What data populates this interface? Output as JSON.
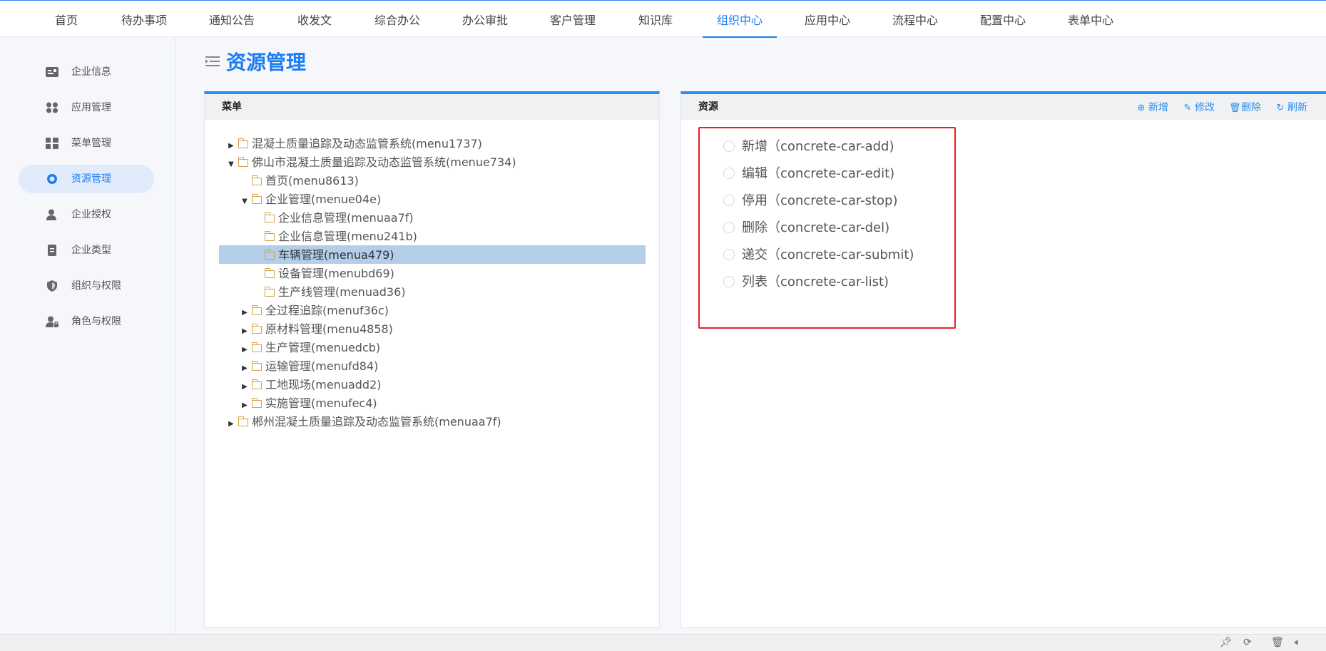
{
  "topnav": {
    "tabs": [
      {
        "label": "首页"
      },
      {
        "label": "待办事项"
      },
      {
        "label": "通知公告"
      },
      {
        "label": "收发文"
      },
      {
        "label": "综合办公"
      },
      {
        "label": "办公审批"
      },
      {
        "label": "客户管理"
      },
      {
        "label": "知识库"
      },
      {
        "label": "组织中心"
      },
      {
        "label": "应用中心"
      },
      {
        "label": "流程中心"
      },
      {
        "label": "配置中心"
      },
      {
        "label": "表单中心"
      }
    ],
    "active_tab": "组织中心"
  },
  "sidebar": {
    "items": [
      {
        "label": "企业信息",
        "icon": "id-card-icon"
      },
      {
        "label": "应用管理",
        "icon": "apps-icon"
      },
      {
        "label": "菜单管理",
        "icon": "menu-grid-icon"
      },
      {
        "label": "资源管理",
        "icon": "resource-icon"
      },
      {
        "label": "企业授权",
        "icon": "user-key-icon"
      },
      {
        "label": "企业类型",
        "icon": "document-icon"
      },
      {
        "label": "组织与权限",
        "icon": "shield-icon"
      },
      {
        "label": "角色与权限",
        "icon": "user-lock-icon"
      }
    ],
    "active_item": "资源管理"
  },
  "page": {
    "title": "资源管理"
  },
  "menu_panel": {
    "title": "菜单",
    "tree": [
      {
        "label": "混凝土质量追踪及动态监管系统(menu1737)",
        "arrow": "collapsed"
      },
      {
        "label": "佛山市混凝土质量追踪及动态监管系统(menue734)",
        "arrow": "expanded"
      },
      {
        "label": "首页(menu8613)",
        "arrow": "none"
      },
      {
        "label": "企业管理(menue04e)",
        "arrow": "expanded"
      },
      {
        "label": "企业信息管理(menuaa7f)",
        "arrow": "none"
      },
      {
        "label": "企业信息管理(menu241b)",
        "arrow": "none"
      },
      {
        "label": "车辆管理(menua479)",
        "arrow": "none",
        "selected": true
      },
      {
        "label": "设备管理(menubd69)",
        "arrow": "none"
      },
      {
        "label": "生产线管理(menuad36)",
        "arrow": "none"
      },
      {
        "label": "全过程追踪(menuf36c)",
        "arrow": "collapsed"
      },
      {
        "label": "原材料管理(menu4858)",
        "arrow": "collapsed"
      },
      {
        "label": "生产管理(menuedcb)",
        "arrow": "collapsed"
      },
      {
        "label": "运输管理(menufd84)",
        "arrow": "collapsed"
      },
      {
        "label": "工地现场(menuadd2)",
        "arrow": "collapsed"
      },
      {
        "label": "实施管理(menufec4)",
        "arrow": "collapsed"
      },
      {
        "label": "郴州混凝土质量追踪及动态监管系统(menuaa7f)",
        "arrow": "collapsed"
      }
    ]
  },
  "resource_panel": {
    "title": "资源",
    "toolbar": {
      "add": "新增",
      "edit": "修改",
      "delete": "删除",
      "refresh": "刷新"
    },
    "resources": [
      {
        "label": "新增（concrete-car-add)"
      },
      {
        "label": "编辑（concrete-car-edit)"
      },
      {
        "label": "停用（concrete-car-stop)"
      },
      {
        "label": "删除（concrete-car-del)"
      },
      {
        "label": "递交（concrete-car-submit)"
      },
      {
        "label": "列表（concrete-car-list)"
      }
    ]
  },
  "colors": {
    "accent": "#1c7cf1",
    "panel_top_border": "#2d8cf0",
    "selected_row": "#b3cee8",
    "highlight_box": "#e81d25",
    "folder": "#d3a347"
  }
}
